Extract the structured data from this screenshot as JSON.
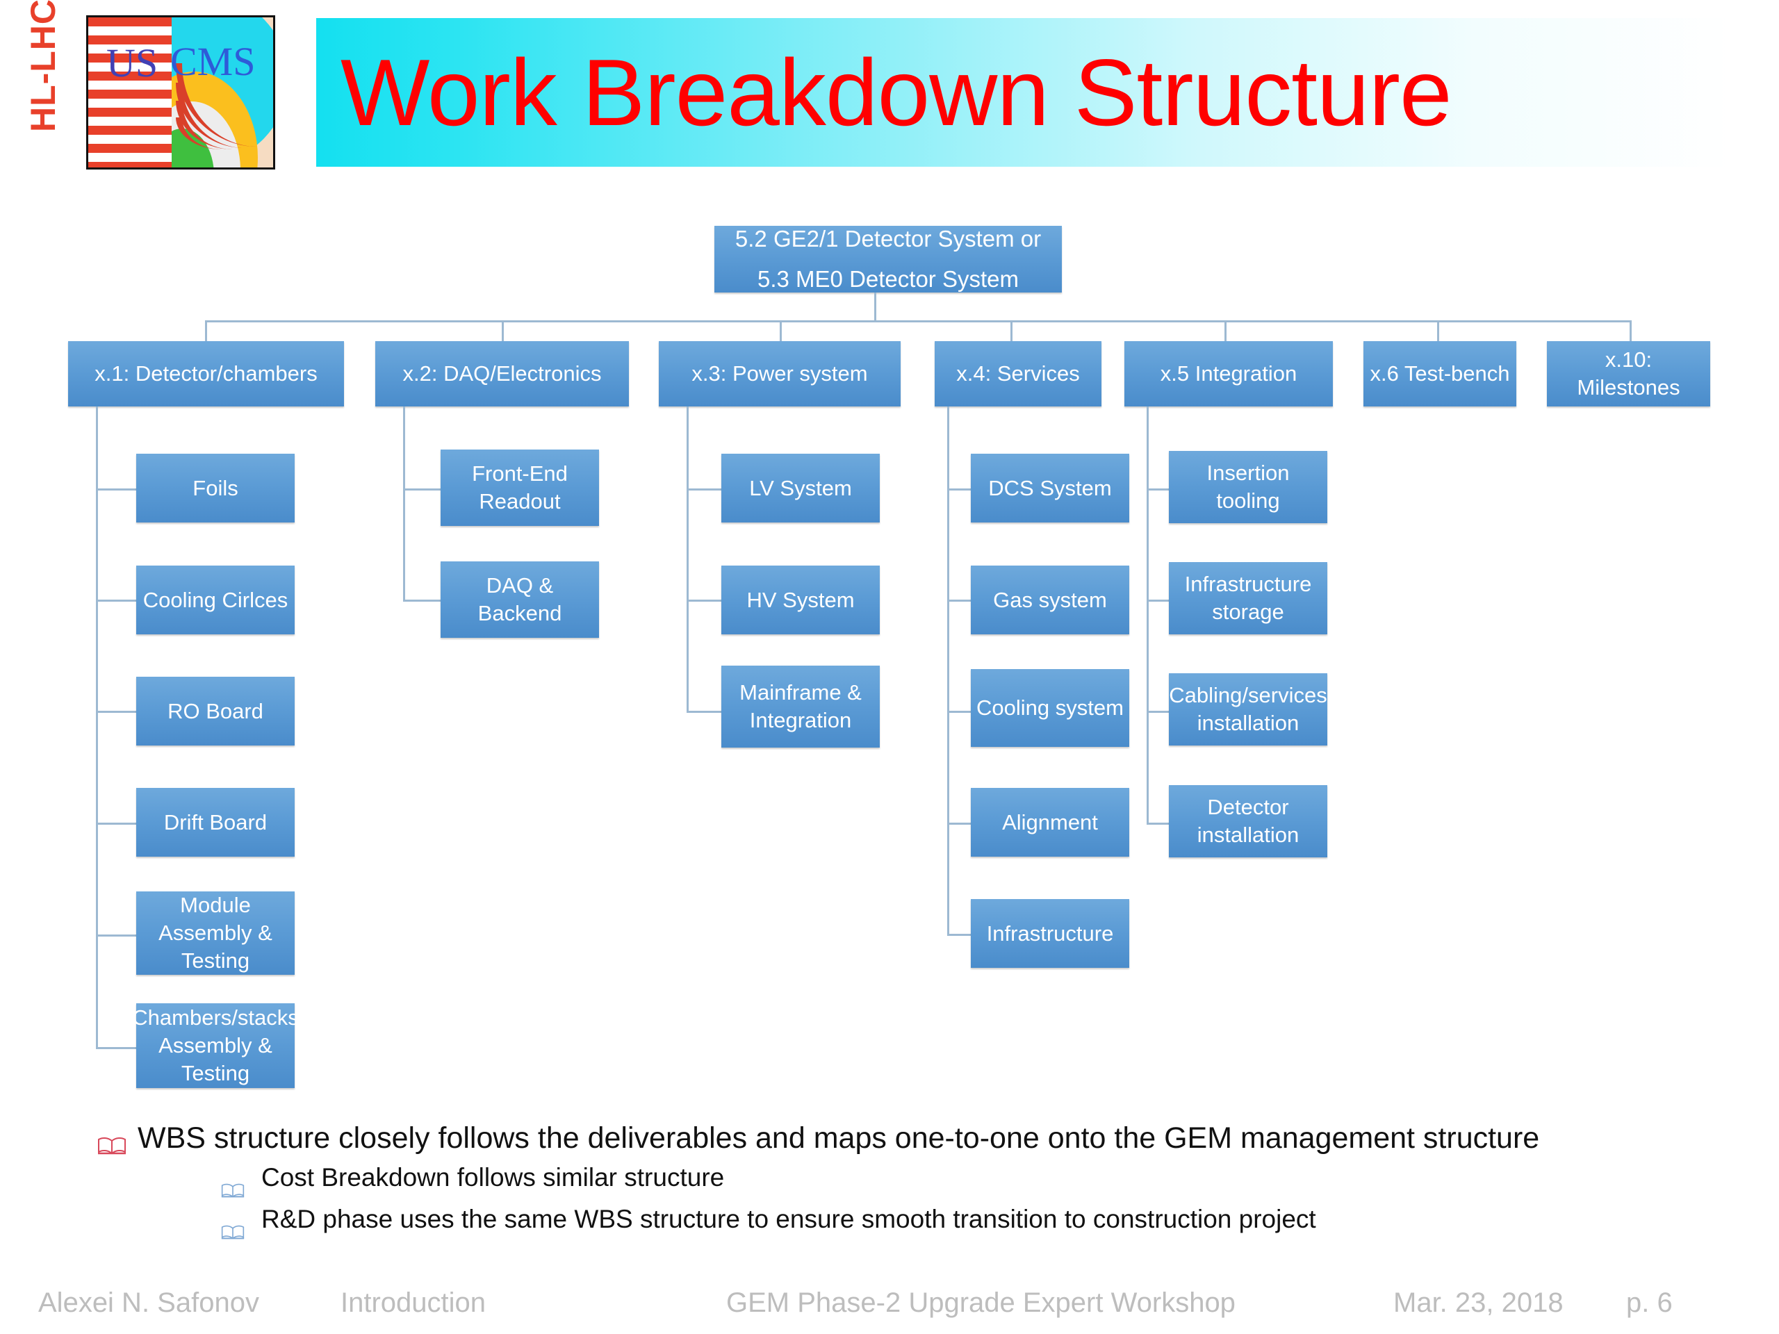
{
  "header": {
    "title": "Work Breakdown Structure",
    "logo_left_text": "HL-LHC",
    "logo_us": "US",
    "logo_cms": "CMS",
    "title_color": "#FF0000",
    "band_color": "#14E0F0"
  },
  "chart": {
    "node_color": "#5B9BD5",
    "connector_color": "#9DB9D2",
    "root": "5.2 GE2/1 Detector System or\n5.3 ME0 Detector System",
    "root_line1": "5.2 GE2/1 Detector System or",
    "root_line2": "5.3 ME0 Detector System",
    "level1": [
      {
        "label": "x.1: Detector/chambers"
      },
      {
        "label": "x.2: DAQ/Electronics"
      },
      {
        "label": "x.3: Power system"
      },
      {
        "label": "x.4: Services"
      },
      {
        "label": "x.5 Integration"
      },
      {
        "label": "x.6 Test-bench"
      },
      {
        "label": "x.10: Milestones"
      }
    ],
    "detector_children": [
      "Foils",
      "Cooling Cirlces",
      "RO Board",
      "Drift Board",
      "Module Assembly & Testing",
      "Chambers/stacks Assembly & Testing"
    ],
    "daq_children": [
      "Front-End Readout",
      "DAQ & Backend"
    ],
    "power_children": [
      "LV System",
      "HV System",
      "Mainframe & Integration"
    ],
    "services_children": [
      "DCS System",
      "Gas system",
      "Cooling system",
      "Alignment",
      "Infrastructure"
    ],
    "integration_children": [
      "Insertion tooling",
      "Infrastructure storage",
      "Cabling/services installation",
      "Detector installation"
    ]
  },
  "bullets": {
    "main": "WBS structure closely follows the deliverables and maps one-to-one onto the GEM management structure",
    "sub": [
      "Cost Breakdown follows similar structure",
      "R&D phase uses the same WBS structure to ensure smooth transition to construction project"
    ]
  },
  "footer": {
    "author": "Alexei N. Safonov",
    "section": "Introduction",
    "event": "GEM Phase-2 Upgrade Expert Workshop",
    "date": "Mar. 23,  2018",
    "page": "p. 6"
  }
}
